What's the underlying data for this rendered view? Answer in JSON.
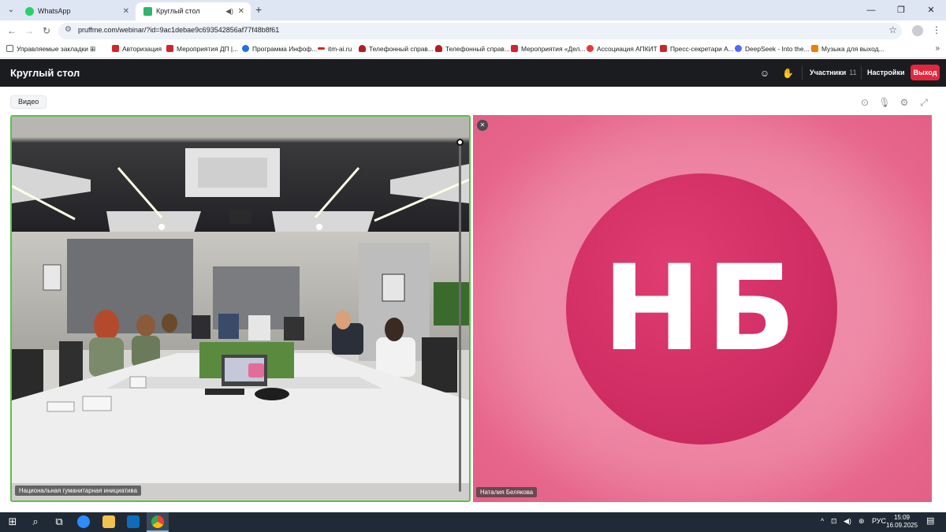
{
  "browser": {
    "tabs": [
      {
        "title": "WhatsApp",
        "icon": "whatsapp-icon",
        "active": false
      },
      {
        "title": "Круглый стол",
        "icon": "video-conference-icon",
        "active": true
      }
    ],
    "url": "pruffme.com/webinar/?id=9ac1debae9c693542856af77f48b8f61",
    "bookmarks": [
      {
        "label": "Управляемые закладки",
        "icon": "folder-icon",
        "color": "#5f6368"
      },
      {
        "label": "Авторизация",
        "icon": "ap-icon",
        "color": "#d3242c"
      },
      {
        "label": "Мероприятия ДП |...",
        "icon": "dp-icon",
        "color": "#d3242c"
      },
      {
        "label": "Программа Инфоф...",
        "icon": "program-icon",
        "color": "#1a73e8"
      },
      {
        "label": "itm-ai.ru",
        "icon": "itm-icon",
        "color": "#c62828"
      },
      {
        "label": "Телефонный справ...",
        "icon": "emblem-icon",
        "color": "#b71c1c"
      },
      {
        "label": "Телефонный справ...",
        "icon": "emblem-icon",
        "color": "#b71c1c"
      },
      {
        "label": "Мероприятия «Дел...",
        "icon": "dp-icon",
        "color": "#d3242c"
      },
      {
        "label": "Ассоциация АПКИТ",
        "icon": "apkit-icon",
        "color": "#e53935"
      },
      {
        "label": "Пресс-секретари А...",
        "icon": "press-icon",
        "color": "#c62828"
      },
      {
        "label": "DeepSeek - Into the...",
        "icon": "deepseek-icon",
        "color": "#4d6bfe"
      },
      {
        "label": "Музыка для выход...",
        "icon": "music-icon",
        "color": "#f57c00"
      }
    ]
  },
  "app": {
    "title": "Круглый стол",
    "participants_label": "Участники",
    "participants_count": "11",
    "settings_label": "Настройки",
    "exit_label": "Выход",
    "video_tab_label": "Видео",
    "accent_color": "#e5263c",
    "speaking_border_color": "#58c14a"
  },
  "tiles": [
    {
      "name": "Национальная гуманитарная инициатива",
      "type": "camera"
    },
    {
      "name": "Наталия Белякова",
      "type": "avatar",
      "initials": "НБ",
      "muted": true
    }
  ],
  "taskbar": {
    "language": "РУС",
    "time": "15:09",
    "date": "16.09.2025"
  }
}
